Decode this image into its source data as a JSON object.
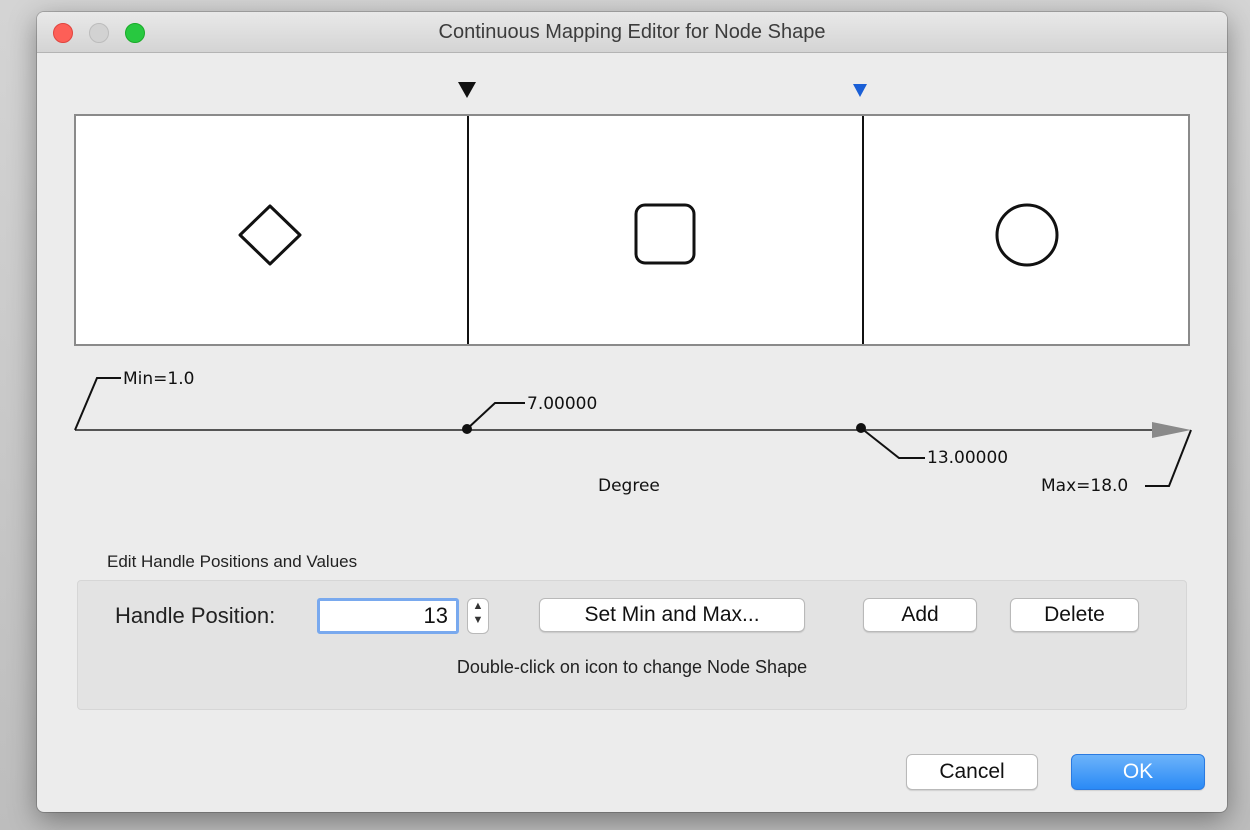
{
  "window": {
    "title": "Continuous Mapping Editor for Node Shape"
  },
  "mapping_panel": {
    "segments": [
      {
        "shape": "diamond-icon"
      },
      {
        "shape": "rounded-rectangle-icon"
      },
      {
        "shape": "ellipse-icon"
      }
    ],
    "selected_handle": 2
  },
  "axis": {
    "min_label": "Min=1.0",
    "max_label": "Max=18.0",
    "attribute_label": "Degree",
    "handle_labels": [
      "7.00000",
      "13.00000"
    ],
    "handle_values": [
      7.0,
      13.0
    ],
    "min_value": 1.0,
    "max_value": 18.0
  },
  "edit_section": {
    "title": "Edit Handle Positions and Values",
    "handle_position_label": "Handle Position:",
    "handle_position_value": "13",
    "set_min_max_label": "Set Min and Max...",
    "add_label": "Add",
    "delete_label": "Delete",
    "hint": "Double-click on icon to change Node Shape"
  },
  "footer": {
    "cancel_label": "Cancel",
    "ok_label": "OK"
  },
  "colors": {
    "accent": "#2a8af6",
    "selected_handle": "#1a5fd6",
    "close": "#fd5f57",
    "zoom": "#28c840"
  }
}
